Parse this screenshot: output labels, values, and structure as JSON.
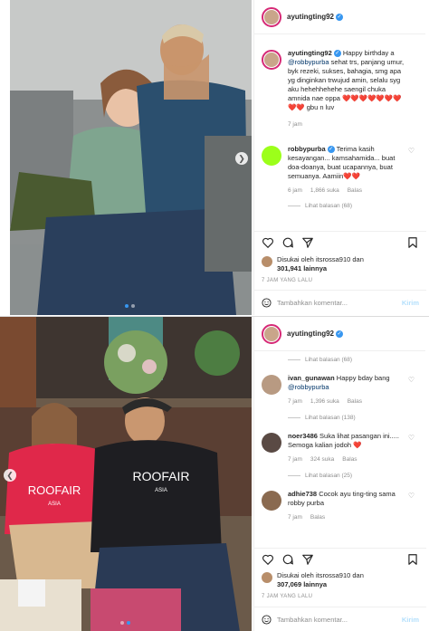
{
  "post1": {
    "username": "ayutingting92",
    "caption": {
      "user": "ayutingting92",
      "text_before": " Happy birthday a ",
      "mention": "@robbypurba",
      "text_after": " sehat trs, panjang umur, byk rezeki, sukses, bahagia, smg apa yg dinginkan trwujud amin, selalu syg aku hehehhehehe saengil chuka amnida nae oppa ❤️❤️❤️❤️❤️❤️❤️❤️❤️ gbu n luv",
      "time": "7 jam"
    },
    "comment": {
      "user": "robbypurba",
      "text": " Terima kasih kesayangan... kamsahamida... buat doa-doanya, buat ucapannya, buat semuanya. Aamiin❤️❤️",
      "time": "6 jam",
      "likes": "1,866 suka",
      "reply": "Balas",
      "view_replies": "Lihat balasan (68)"
    },
    "liked_by": "Disukai oleh itsrossa910 dan",
    "likes_count": "301,941 lainnya",
    "timestamp": "7 JAM YANG LALU",
    "add_comment_placeholder": "Tambahkan komentar...",
    "post_label": "Kirim"
  },
  "post2": {
    "username": "ayutingting92",
    "view_replies_top": "Lihat balasan (68)",
    "comments": [
      {
        "user": "ivan_gunawan",
        "text": " Happy bday bang ",
        "mention": "@robbypurba",
        "time": "7 jam",
        "likes": "1,396 suka",
        "reply": "Balas",
        "view_replies": "Lihat balasan (138)"
      },
      {
        "user": "noer3486",
        "text": " Suka lihat pasangan ini..... Semoga kalian jodoh ❤️",
        "mention": "",
        "time": "7 jam",
        "likes": "324 suka",
        "reply": "Balas",
        "view_replies": "Lihat balasan (25)"
      },
      {
        "user": "adhie738",
        "text": " Cocok ayu ting-ting sama robby purba",
        "mention": "",
        "time": "7 jam",
        "likes": "",
        "reply": "Balas",
        "view_replies": ""
      }
    ],
    "liked_by": "Disukai oleh itsrossa910 dan",
    "likes_count": "307,069 lainnya",
    "timestamp": "7 JAM YANG LALU",
    "add_comment_placeholder": "Tambahkan komentar...",
    "post_label": "Kirim",
    "shirt_text_1": "ROOFAIR",
    "shirt_sub_1": "ASIA",
    "shirt_text_2": "ROOFAIR",
    "shirt_sub_2": "ASIA"
  },
  "icons": [
    "heart-icon",
    "comment-icon",
    "share-icon",
    "bookmark-icon",
    "smile-icon",
    "verified-icon",
    "chevron-right-icon",
    "chevron-left-icon"
  ],
  "colors": {
    "accent": "#3897f0",
    "ring": "#d62976",
    "muted": "#8e8e8e"
  }
}
